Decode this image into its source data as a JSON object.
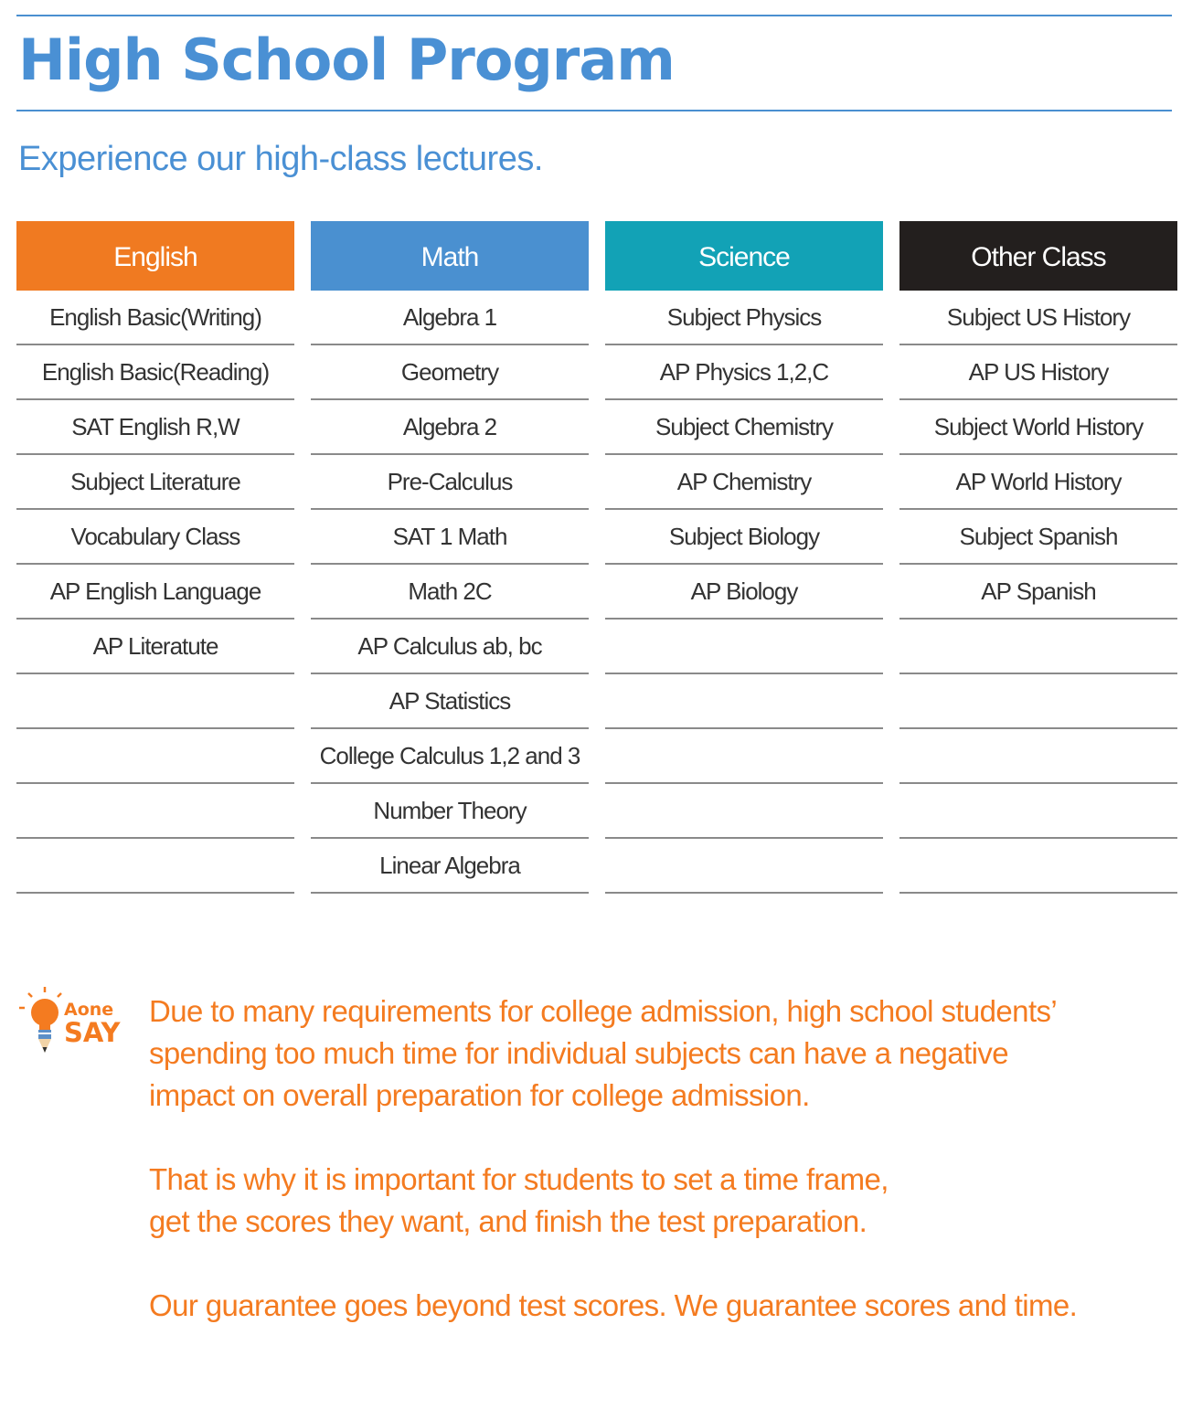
{
  "page": {
    "title": "High School Program",
    "subtitle": "Experience our high-class lectures."
  },
  "columns": [
    {
      "header": "English",
      "color": "#f07a21",
      "items": [
        "English Basic(Writing)",
        "English Basic(Reading)",
        "SAT English R,W",
        "Subject Literature",
        "Vocabulary Class",
        "AP English Language",
        "AP Literatute",
        "",
        "",
        "",
        ""
      ]
    },
    {
      "header": "Math",
      "color": "#4a90d0",
      "items": [
        "Algebra 1",
        "Geometry",
        "Algebra 2",
        "Pre-Calculus",
        "SAT 1 Math",
        "Math 2C",
        "AP Calculus ab, bc",
        "AP Statistics",
        "College Calculus 1,2 and 3",
        "Number Theory",
        "Linear Algebra"
      ]
    },
    {
      "header": "Science",
      "color": "#12a2b6",
      "items": [
        "Subject Physics",
        "AP Physics 1,2,C",
        "Subject Chemistry",
        "AP Chemistry",
        "Subject Biology",
        "AP Biology",
        "",
        "",
        "",
        "",
        ""
      ]
    },
    {
      "header": "Other Class",
      "color": "#231f1e",
      "items": [
        "Subject US History",
        "AP US History",
        "Subject World History",
        "AP World History",
        "Subject Spanish",
        "AP Spanish",
        "",
        "",
        "",
        "",
        ""
      ]
    }
  ],
  "aone_say": {
    "logo_line1": "Aone",
    "logo_line2": "SAY",
    "icon": "lightbulb-pencil-icon",
    "paragraph1": [
      "Due to many requirements for college admission, high school students’",
      "spending too much time for individual subjects can have a negative",
      "impact on overall preparation for college admission."
    ],
    "paragraph2": [
      "That is why it is important for students to set a time frame,",
      "get the scores they want, and finish the test preparation."
    ],
    "paragraph3": [
      "Our guarantee goes beyond test scores. We guarantee scores and time."
    ]
  }
}
